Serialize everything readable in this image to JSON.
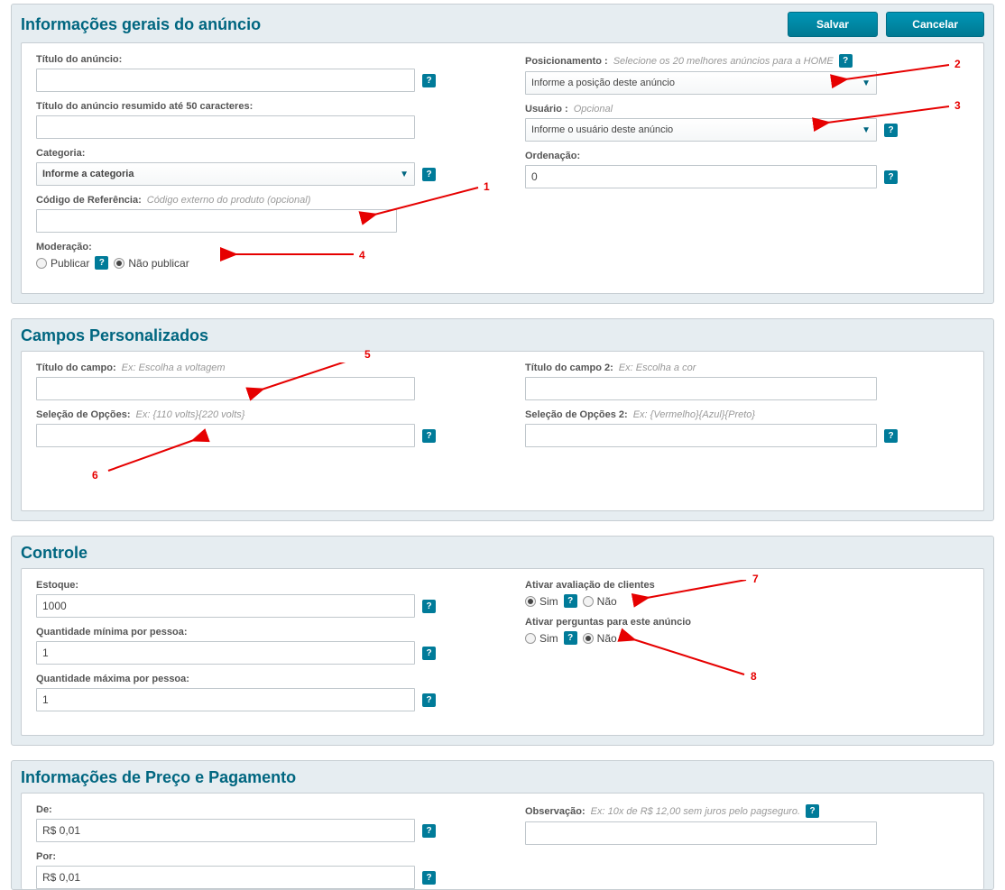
{
  "header": {
    "title": "Informações gerais do anúncio",
    "save_label": "Salvar",
    "cancel_label": "Cancelar"
  },
  "general": {
    "titulo_label": "Título do anúncio:",
    "titulo_value": "",
    "titulo_resumido_label": "Título do anúncio resumido até 50 caracteres:",
    "titulo_resumido_value": "",
    "categoria_label": "Categoria:",
    "categoria_placeholder": "Informe a categoria",
    "codigo_ref_label": "Código de Referência:",
    "codigo_ref_hint": "Código externo do produto (opcional)",
    "codigo_ref_value": "",
    "moderacao_label": "Moderação:",
    "radio_publicar": "Publicar",
    "radio_nao_publicar": "Não publicar",
    "posicionamento_label": "Posicionamento :",
    "posicionamento_hint": "Selecione os 20 melhores anúncios para a HOME",
    "posicionamento_placeholder": "Informe a posição deste anúncio",
    "usuario_label": "Usuário :",
    "usuario_hint": "Opcional",
    "usuario_placeholder": "Informe o usuário deste anúncio",
    "ordenacao_label": "Ordenação:",
    "ordenacao_value": "0"
  },
  "campos": {
    "title": "Campos Personalizados",
    "titulo_campo_label": "Título do campo:",
    "titulo_campo_hint": "Ex: Escolha a voltagem",
    "selecao_opcoes_label": "Seleção de Opções:",
    "selecao_opcoes_hint": "Ex: {110 volts}{220 volts}",
    "titulo_campo2_label": "Título do campo 2:",
    "titulo_campo2_hint": "Ex: Escolha a cor",
    "selecao_opcoes2_label": "Seleção de Opções 2:",
    "selecao_opcoes2_hint": "Ex: {Vermelho}{Azul}{Preto}"
  },
  "controle": {
    "title": "Controle",
    "estoque_label": "Estoque:",
    "estoque_value": "1000",
    "qtd_min_label": "Quantidade mínima por pessoa:",
    "qtd_min_value": "1",
    "qtd_max_label": "Quantidade máxima por pessoa:",
    "qtd_max_value": "1",
    "avaliacao_label": "Ativar avaliação de clientes",
    "perguntas_label": "Ativar perguntas para este anúncio",
    "radio_sim": "Sim",
    "radio_nao": "Não"
  },
  "preco": {
    "title": "Informações de Preço e Pagamento",
    "de_label": "De:",
    "de_value": "R$ 0,01",
    "por_label": "Por:",
    "por_value": "R$ 0,01",
    "obs_label": "Observação:",
    "obs_hint": "Ex: 10x de R$ 12,00 sem juros pelo pagseguro."
  },
  "annotations": {
    "1": "1",
    "2": "2",
    "3": "3",
    "4": "4",
    "5": "5",
    "6": "6",
    "7": "7",
    "8": "8"
  }
}
